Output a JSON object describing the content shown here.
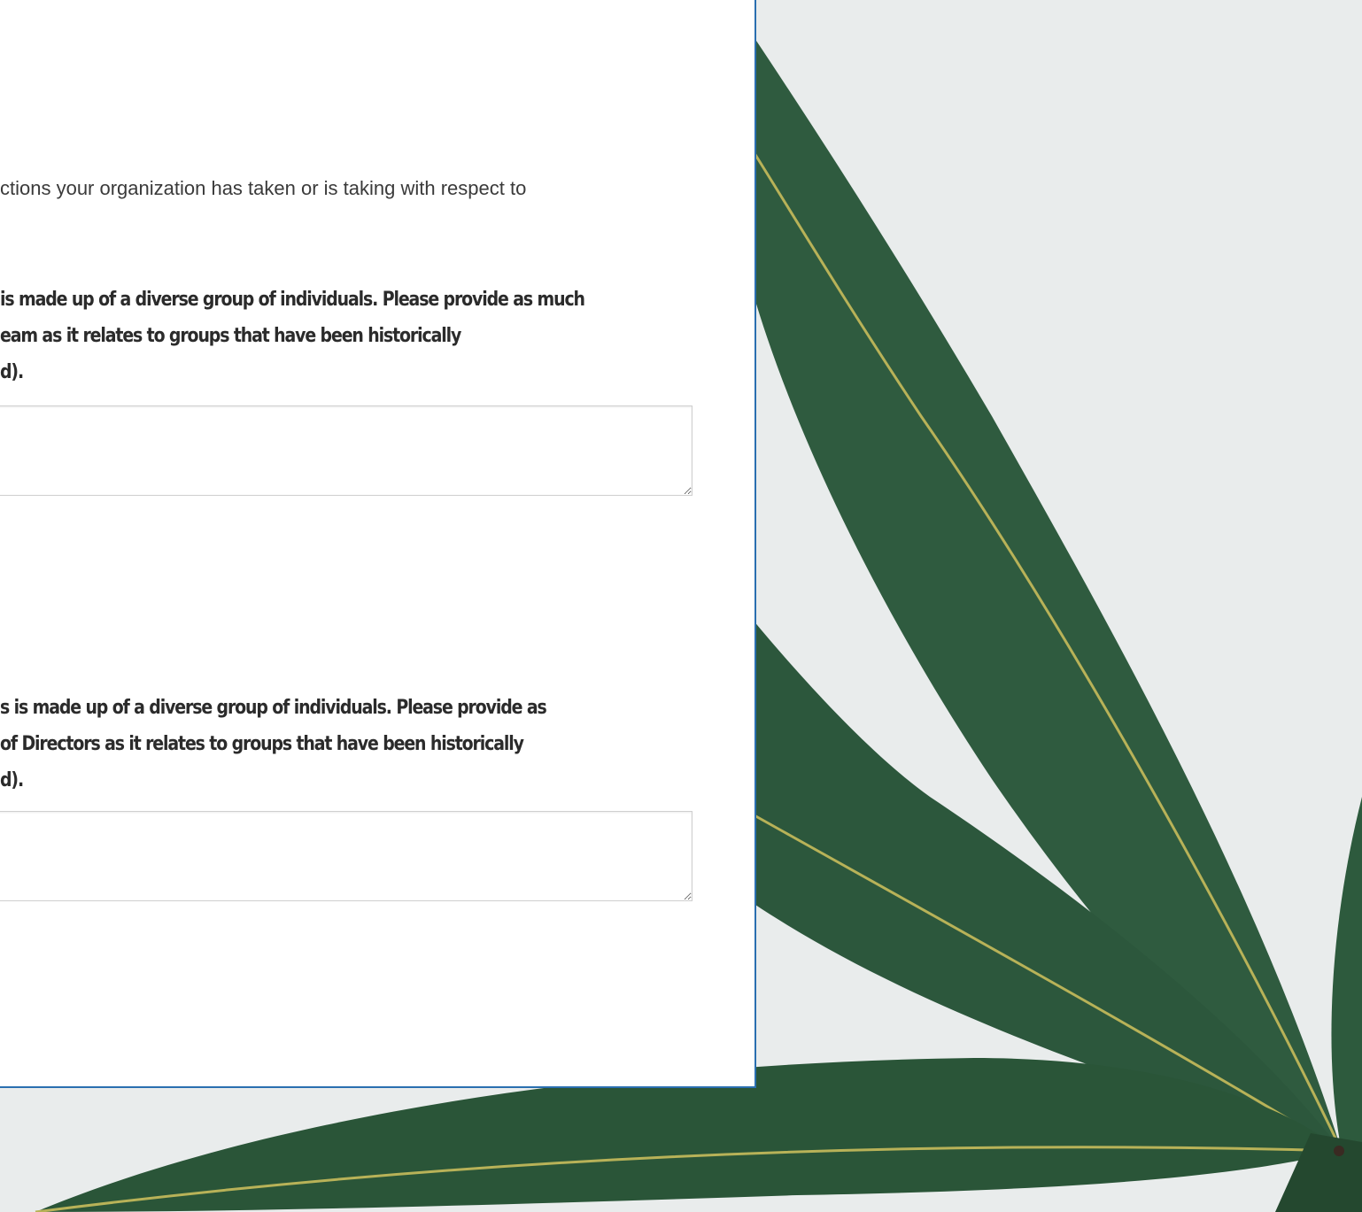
{
  "background": {
    "image": "cannabis-leaf-photo",
    "sky_color": "#e9ecec",
    "leaf_color": "#2f5b3f"
  },
  "form": {
    "intro_text": "ctions your organization has taken or is taking with respect to",
    "question1": {
      "lines": [
        "is made up of a diverse group of individuals. Please provide as much",
        "eam as it relates to groups that have been historically",
        "d)."
      ],
      "answer_value": ""
    },
    "question2": {
      "lines": [
        "s is made up of a diverse group of individuals. Please provide as",
        " of Directors as it relates to groups that have been historically",
        "d)."
      ],
      "answer_value": ""
    }
  }
}
